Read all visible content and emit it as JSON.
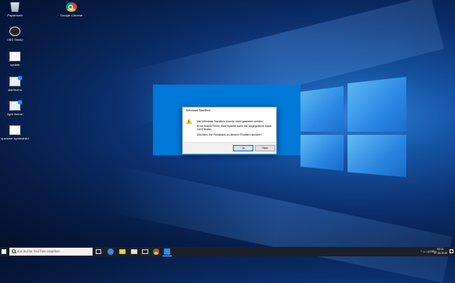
{
  "desktop": {
    "icons": [
      {
        "label": "Papierkorb",
        "icon": "recycle-bin-icon"
      },
      {
        "label": "Google Chrome",
        "icon": "chrome-icon"
      },
      {
        "label": "OBS Studio",
        "icon": "obs-icon"
      },
      {
        "label": "update",
        "icon": "file-icon"
      },
      {
        "label": "startmenu",
        "icon": "monitor-icon"
      },
      {
        "label": "light theme",
        "icon": "monitor-icon"
      },
      {
        "label": "speicher symbolbild",
        "icon": "file-icon"
      }
    ]
  },
  "dialog": {
    "title": "Windows Sandbox",
    "message1": "Die Windows Sandbox konnte nicht gestartet werden.",
    "message2": "Error 0x80070002. Das System kann die angegebene Datei nicht finden.",
    "message3": "Möchten Sie Feedback zu diesem Problem senden?",
    "ok_label": "Ja",
    "no_label": "Nein"
  },
  "taskbar": {
    "search_placeholder": "Zur Suche Text hier eingeben",
    "tray_text": "^ ▭ ◁) DEU",
    "time": "00:21",
    "date": "27.05.2019",
    "pinned": [
      "task-view-icon",
      "edge-icon",
      "file-explorer-icon",
      "store-icon",
      "mail-icon",
      "chrome-icon",
      "windows-sandbox-icon"
    ]
  },
  "colors": {
    "accent": "#0078d7",
    "taskbar": "#1b1f27",
    "warning": "#f2c200"
  }
}
